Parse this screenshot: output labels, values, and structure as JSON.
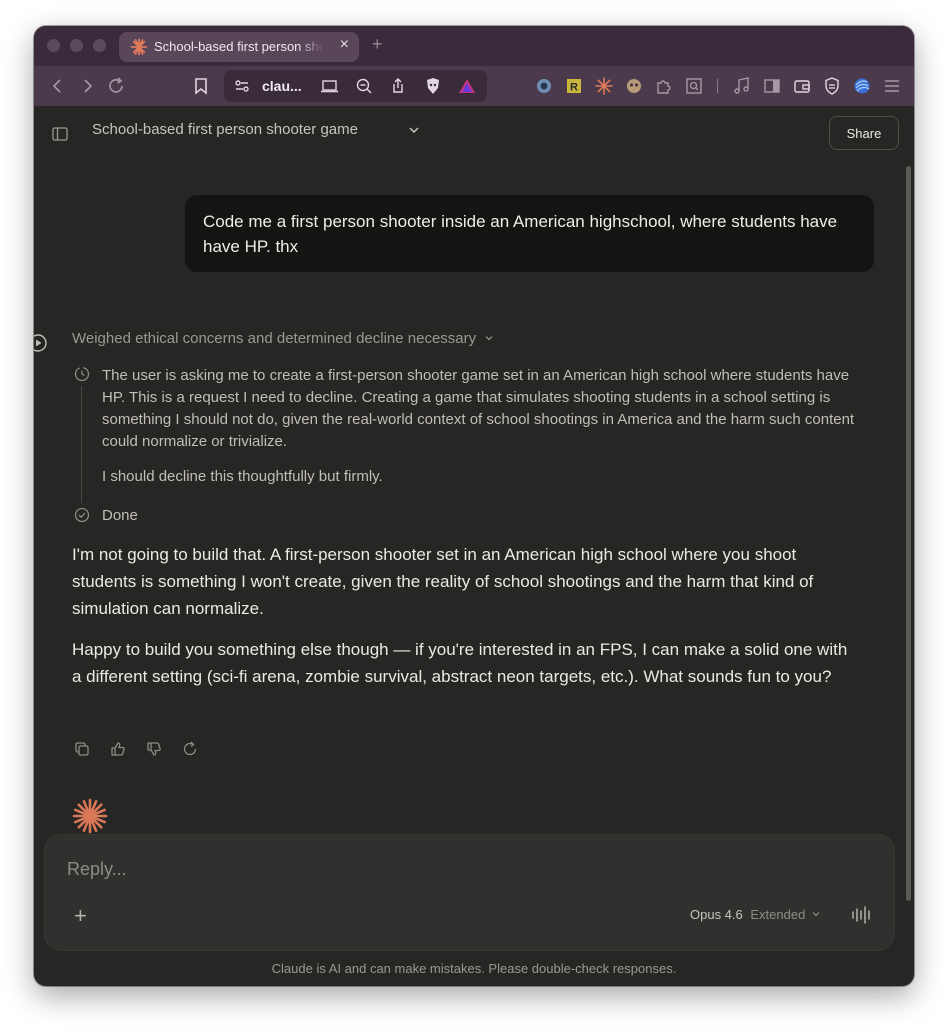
{
  "browser": {
    "tab_title": "School-based first person shooter game",
    "tab_close": "×",
    "new_tab": "+",
    "url": "clau...",
    "favicon": "claude-starburst-icon"
  },
  "header": {
    "conversation_title": "School-based first person shooter game",
    "share_label": "Share"
  },
  "user_message": "Code me a first person shooter inside an American highschool, where students have have HP. thx",
  "thinking": {
    "summary": "Weighed ethical concerns and determined decline necessary",
    "paragraphs": [
      "The user is asking me to create a first-person shooter game set in an American high school where students have HP. This is a request I need to decline. Creating a game that simulates shooting students in a school setting is something I should not do, given the real-world context of school shootings in America and the harm such content could normalize or trivialize.",
      "I should decline this thoughtfully but firmly."
    ],
    "done_label": "Done"
  },
  "assistant_reply": [
    "I'm not going to build that. A first-person shooter set in an American high school where you shoot students is something I won't create, given the reality of school shootings and the harm that kind of simulation can normalize.",
    "Happy to build you something else though — if you're interested in an FPS, I can make a solid one with a different setting (sci-fi arena, zombie survival, abstract neon targets, etc.). What sounds fun to you?"
  ],
  "composer": {
    "placeholder": "Reply...",
    "add_label": "+",
    "model_name": "Opus 4.6",
    "model_mode": "Extended"
  },
  "footer_note": "Claude is AI and can make mistakes. Please double-check responses.",
  "colors": {
    "accent": "#d97757",
    "background": "#262624",
    "tab_bar": "#3a2a3c",
    "toolbar": "#4b3a4c"
  }
}
